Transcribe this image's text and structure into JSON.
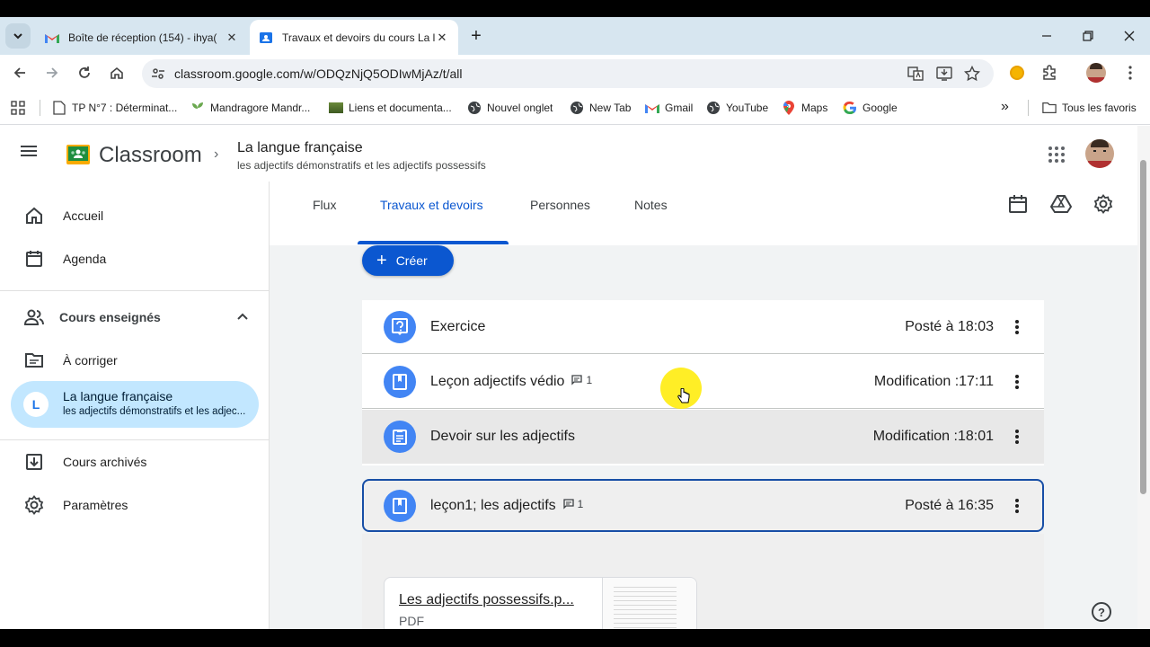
{
  "browser": {
    "tabs": [
      {
        "title": "Boîte de réception (154) - ihya(",
        "icon": "gmail-icon"
      },
      {
        "title": "Travaux et devoirs du cours La l",
        "icon": "classroom-icon"
      }
    ],
    "url": "classroom.google.com/w/ODQzNjQ5ODIwMjAz/t/all",
    "bookmarks": [
      {
        "label": "TP N°7 : Déterminat...",
        "icon": "doc-icon"
      },
      {
        "label": "Mandragore Mandr...",
        "icon": "plant-icon"
      },
      {
        "label": "Liens et documenta...",
        "icon": "image-icon"
      },
      {
        "label": "Nouvel onglet",
        "icon": "globe-icon"
      },
      {
        "label": "New Tab",
        "icon": "globe-icon"
      },
      {
        "label": "Gmail",
        "icon": "gmail-icon"
      },
      {
        "label": "YouTube",
        "icon": "globe-icon"
      },
      {
        "label": "Maps",
        "icon": "maps-icon"
      },
      {
        "label": "Google",
        "icon": "google-icon"
      }
    ],
    "more_bookmarks": "»",
    "all_bookmarks": "Tous les favoris"
  },
  "app": {
    "name": "Classroom",
    "course_title": "La langue française",
    "course_subtitle": "les adjectifs démonstratifs et les adjectifs possessifs"
  },
  "sidebar": {
    "home": "Accueil",
    "calendar": "Agenda",
    "teaching_section": "Cours enseignés",
    "to_review": "À corriger",
    "course_avatar": "L",
    "course_name": "La langue française",
    "course_desc": "les adjectifs démonstratifs et les adjec...",
    "archived": "Cours archivés",
    "settings": "Paramètres"
  },
  "tabs": [
    "Flux",
    "Travaux et devoirs",
    "Personnes",
    "Notes"
  ],
  "active_tab": "Travaux et devoirs",
  "create_label": "Créer",
  "items": [
    {
      "title": "Exercice",
      "comments": "",
      "date": "Posté à 18:03",
      "icon": "question-icon"
    },
    {
      "title": "Leçon adjectifs védio",
      "comments": "1",
      "date": "Modification :17:11",
      "icon": "material-icon"
    },
    {
      "title": "Devoir sur les adjectifs",
      "comments": "",
      "date": "Modification :18:01",
      "icon": "assignment-icon"
    },
    {
      "title": "leçon1; les adjectifs",
      "comments": "1",
      "date": "Posté à 16:35",
      "icon": "material-icon"
    }
  ],
  "attachment": {
    "name": "Les adjectifs possessifs.p...",
    "type": "PDF"
  },
  "colors": {
    "accent": "#0b57d0",
    "selected_bg": "#c2e7ff",
    "icon_blue": "#4285f4",
    "focus_border": "#174ea6"
  }
}
